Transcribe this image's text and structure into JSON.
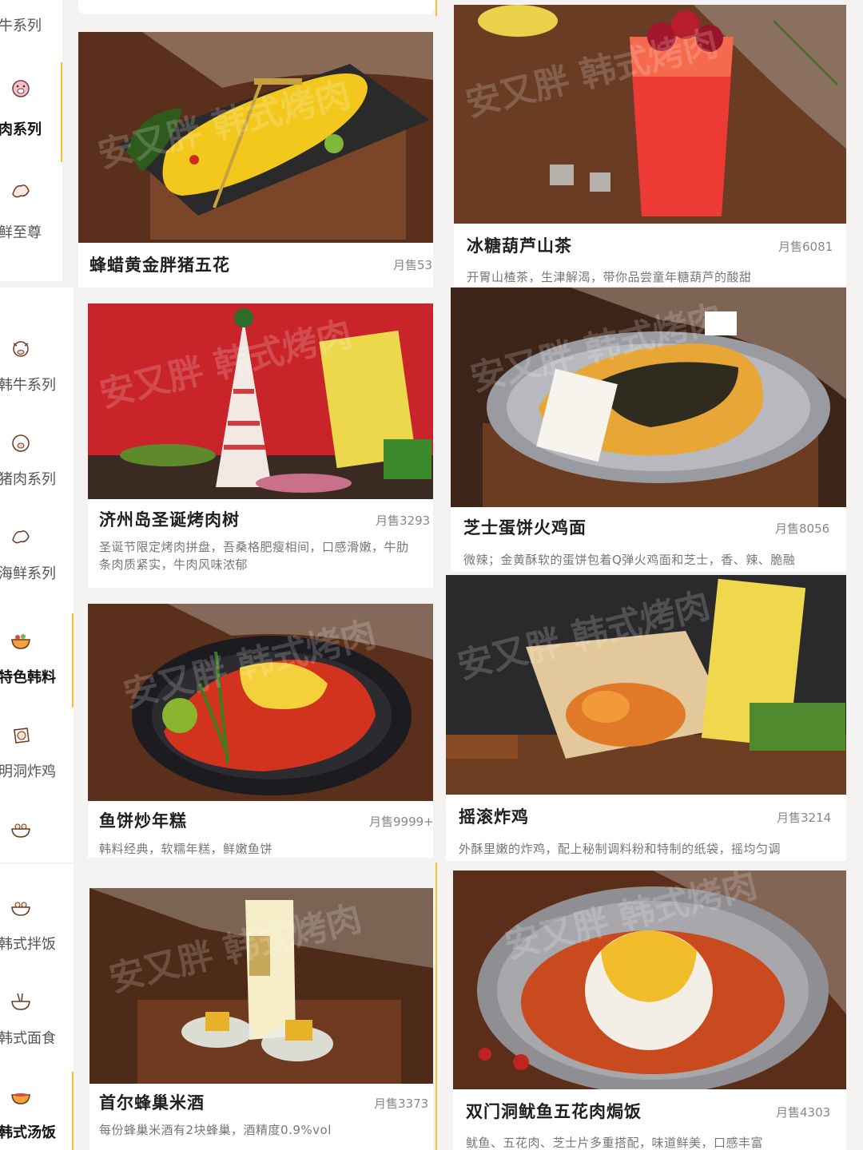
{
  "categories": [
    {
      "label": "牛系列",
      "icon": "beef-icon"
    },
    {
      "label": "肉系列",
      "icon": "pig-icon"
    },
    {
      "label": "鲜至尊",
      "icon": "seafood-icon"
    },
    {
      "label": "韩牛系列",
      "icon": "cow-icon"
    },
    {
      "label": "猪肉系列",
      "icon": "pig-icon"
    },
    {
      "label": "海鲜系列",
      "icon": "seafood-icon"
    },
    {
      "label": "特色韩料",
      "icon": "bowl-icon"
    },
    {
      "label": "明洞炸鸡",
      "icon": "fried-chicken-icon"
    },
    {
      "label": "韩式拌饭",
      "icon": "bibimbap-icon"
    },
    {
      "label": "韩式面食",
      "icon": "noodle-icon"
    },
    {
      "label": "韩式汤饭",
      "icon": "soup-icon"
    }
  ],
  "watermark": "安又胖 韩式烤肉",
  "products": [
    {
      "name": "蜂蜡黄金胖猪五花",
      "sales": "月售53",
      "desc": ""
    },
    {
      "name": "冰糖葫芦山茶",
      "sales": "月售6081",
      "desc": "开胃山楂茶，生津解渴，带你品尝童年糖葫芦的酸甜"
    },
    {
      "name": "济州岛圣诞烤肉树",
      "sales": "月售3293",
      "desc": "圣诞节限定烤肉拼盘，吾桑格肥瘦相间，口感滑嫩，牛肋条肉质紧实，牛肉风味浓郁"
    },
    {
      "name": "芝士蛋饼火鸡面",
      "sales": "月售8056",
      "desc": "微辣；金黄酥软的蛋饼包着Q弹火鸡面和芝士，香、辣、脆融"
    },
    {
      "name": "鱼饼炒年糕",
      "sales": "月售9999+",
      "desc": "韩料经典，软糯年糕，鲜嫩鱼饼"
    },
    {
      "name": "摇滚炸鸡",
      "sales": "月售3214",
      "desc": "外酥里嫩的炸鸡，配上秘制调料粉和特制的纸袋，摇均匀调"
    },
    {
      "name": "首尔蜂巢米酒",
      "sales": "月售3373",
      "desc": "每份蜂巢米酒有2块蜂巢，酒精度0.9%vol"
    },
    {
      "name": "双门洞鱿鱼五花肉焗饭",
      "sales": "月售4303",
      "desc": "鱿鱼、五花肉、芝士片多重搭配，味道鲜美，口感丰富"
    }
  ],
  "colors": {
    "accent": "#f2c230",
    "wood": "#6b3a22",
    "page": "#f4f3f1"
  }
}
